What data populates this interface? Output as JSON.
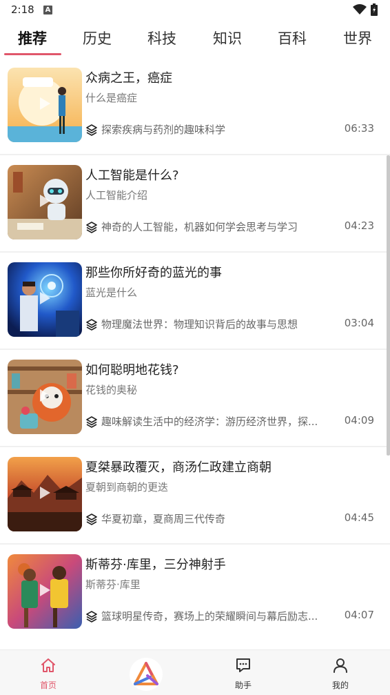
{
  "status_bar": {
    "time": "2:18",
    "notification_icon": "A"
  },
  "tabs": [
    {
      "label": "推荐",
      "active": true
    },
    {
      "label": "历史"
    },
    {
      "label": "科技"
    },
    {
      "label": "知识"
    },
    {
      "label": "百科"
    },
    {
      "label": "世界"
    }
  ],
  "feed": [
    {
      "title": "众病之王，癌症",
      "subtitle": "什么是癌症",
      "description": "探索疾病与药剂的趣味科学",
      "duration": "06:33",
      "thumbnail": "scientist-with-light-bulb"
    },
    {
      "title": "人工智能是什么?",
      "subtitle": "人工智能介绍",
      "description": "神奇的人工智能，机器如何学会思考与学习",
      "duration": "04:23",
      "thumbnail": "robot-at-desk"
    },
    {
      "title": "那些你所好奇的蓝光的事",
      "subtitle": "蓝光是什么",
      "description": "物理魔法世界：物理知识背后的故事与思想",
      "duration": "03:04",
      "thumbnail": "scientist-blue-light"
    },
    {
      "title": "如何聪明地花钱?",
      "subtitle": "花钱的奥秘",
      "description": "趣味解读生活中的经济学：游历经济世界，探...",
      "duration": "04:09",
      "thumbnail": "red-panda-with-coins"
    },
    {
      "title": "夏桀暴政覆灭，商汤仁政建立商朝",
      "subtitle": "夏朝到商朝的更迭",
      "description": "华夏初章，夏商周三代传奇",
      "duration": "04:45",
      "thumbnail": "ancient-palace-battle"
    },
    {
      "title": "斯蒂芬·库里，三分神射手",
      "subtitle": "斯蒂芬·库里",
      "description": "篮球明星传奇，赛场上的荣耀瞬间与幕后励志...",
      "duration": "04:07",
      "thumbnail": "basketball-players"
    }
  ],
  "bottom_nav": [
    {
      "label": "首页",
      "icon": "home-icon",
      "active": true
    },
    {
      "label": "",
      "icon": "app-logo-icon"
    },
    {
      "label": "助手",
      "icon": "chat-icon"
    },
    {
      "label": "我的",
      "icon": "profile-icon"
    }
  ],
  "colors": {
    "accent": "#e0566a",
    "text": "#222222",
    "secondary_text": "#777777",
    "nav_bg": "#f7f7f7"
  }
}
